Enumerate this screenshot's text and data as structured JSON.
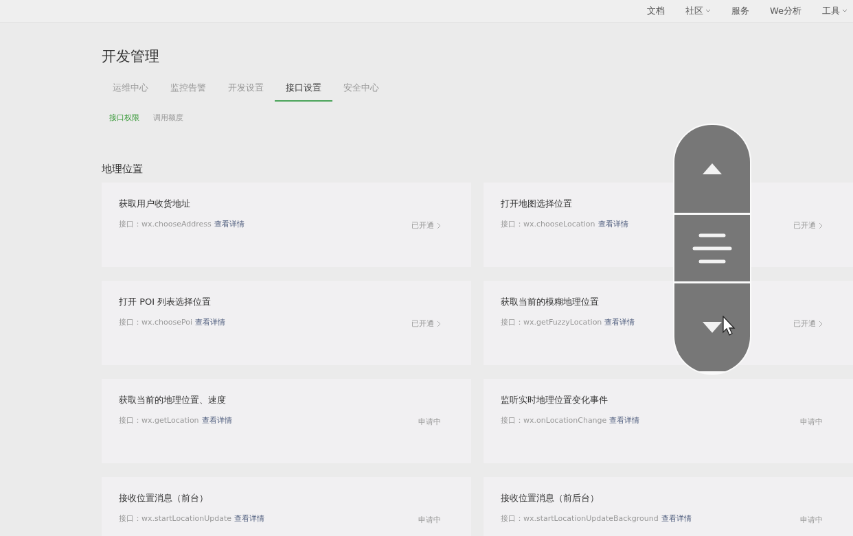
{
  "top_nav": [
    {
      "label": "文档",
      "has_menu": false
    },
    {
      "label": "社区",
      "has_menu": true
    },
    {
      "label": "服务",
      "has_menu": false
    },
    {
      "label": "We分析",
      "has_menu": false
    },
    {
      "label": "工具",
      "has_menu": true
    }
  ],
  "page_title": "开发管理",
  "tabs": [
    {
      "label": "运维中心",
      "selected": false
    },
    {
      "label": "监控告警",
      "selected": false
    },
    {
      "label": "开发设置",
      "selected": false
    },
    {
      "label": "接口设置",
      "selected": true
    },
    {
      "label": "安全中心",
      "selected": false
    }
  ],
  "sub_tabs": [
    {
      "label": "接口权限",
      "selected": true
    },
    {
      "label": "调用额度",
      "selected": false
    }
  ],
  "section_title": "地理位置",
  "cards": [
    {
      "title": "获取用户收货地址",
      "api_label": "接口：wx.chooseAddress",
      "link": "查看详情",
      "status": "已开通",
      "has_arrow": true
    },
    {
      "title": "打开地图选择位置",
      "api_label": "接口：wx.chooseLocation",
      "link": "查看详情",
      "status": "已开通",
      "has_arrow": true
    },
    {
      "title": "打开 POI 列表选择位置",
      "api_label": "接口：wx.choosePoi",
      "link": "查看详情",
      "status": "已开通",
      "has_arrow": true
    },
    {
      "title": "获取当前的模糊地理位置",
      "api_label": "接口：wx.getFuzzyLocation",
      "link": "查看详情",
      "status": "已开通",
      "has_arrow": true
    },
    {
      "title": "获取当前的地理位置、速度",
      "api_label": "接口：wx.getLocation",
      "link": "查看详情",
      "status": "申请中",
      "has_arrow": false
    },
    {
      "title": "监听实时地理位置变化事件",
      "api_label": "接口：wx.onLocationChange",
      "link": "查看详情",
      "status": "申请中",
      "has_arrow": false
    },
    {
      "title": "接收位置消息（前台）",
      "api_label": "接口：wx.startLocationUpdate",
      "link": "查看详情",
      "status": "申请中",
      "has_arrow": false
    },
    {
      "title": "接收位置消息（前后台）",
      "api_label": "接口：wx.startLocationUpdateBackground",
      "link": "查看详情",
      "status": "申请中",
      "has_arrow": false
    }
  ]
}
